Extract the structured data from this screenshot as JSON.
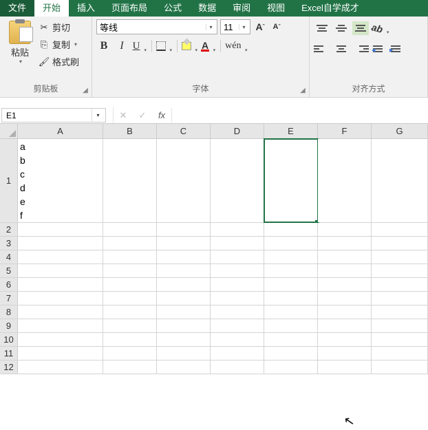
{
  "tabs": {
    "file": "文件",
    "home": "开始",
    "insert": "插入",
    "layout": "页面布局",
    "formulas": "公式",
    "data": "数据",
    "review": "审阅",
    "view": "视图",
    "custom": "Excel自学成才"
  },
  "clipboard": {
    "paste": "粘贴",
    "cut": "剪切",
    "copy": "复制",
    "format_painter": "格式刷",
    "group": "剪贴板"
  },
  "font": {
    "name": "等线",
    "size": "11",
    "increase": "A",
    "decrease": "A",
    "bold": "B",
    "italic": "I",
    "underline": "U",
    "fontcolor_letter": "A",
    "phonetic": "wén",
    "group": "字体"
  },
  "align": {
    "group": "对齐方式",
    "orient": "ab"
  },
  "namebox": "E1",
  "formula": "",
  "columns": [
    "A",
    "B",
    "C",
    "D",
    "E",
    "F",
    "G"
  ],
  "rows": [
    "1",
    "2",
    "3",
    "4",
    "5",
    "6",
    "7",
    "8",
    "9",
    "10",
    "11",
    "12"
  ],
  "cells": {
    "A1": "a\nb\nc\nd\ne\nf"
  }
}
